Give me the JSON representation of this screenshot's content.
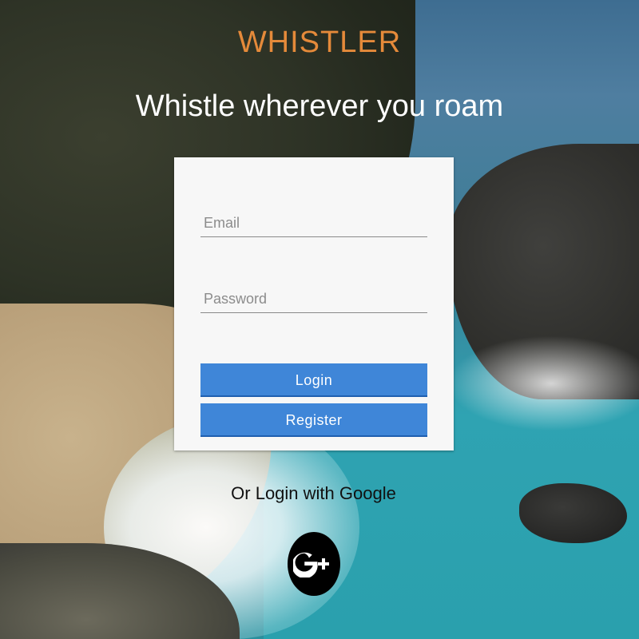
{
  "brand": {
    "name": "WHISTLER",
    "color": "#e58a3a"
  },
  "tagline": "Whistle wherever you roam",
  "login_form": {
    "email": {
      "placeholder": "Email",
      "value": ""
    },
    "password": {
      "placeholder": "Password",
      "value": ""
    },
    "login_label": "Login",
    "register_label": "Register",
    "button_color": "#3f86d8"
  },
  "google": {
    "prompt": "Or Login with Google",
    "icon": "google-plus-icon"
  }
}
